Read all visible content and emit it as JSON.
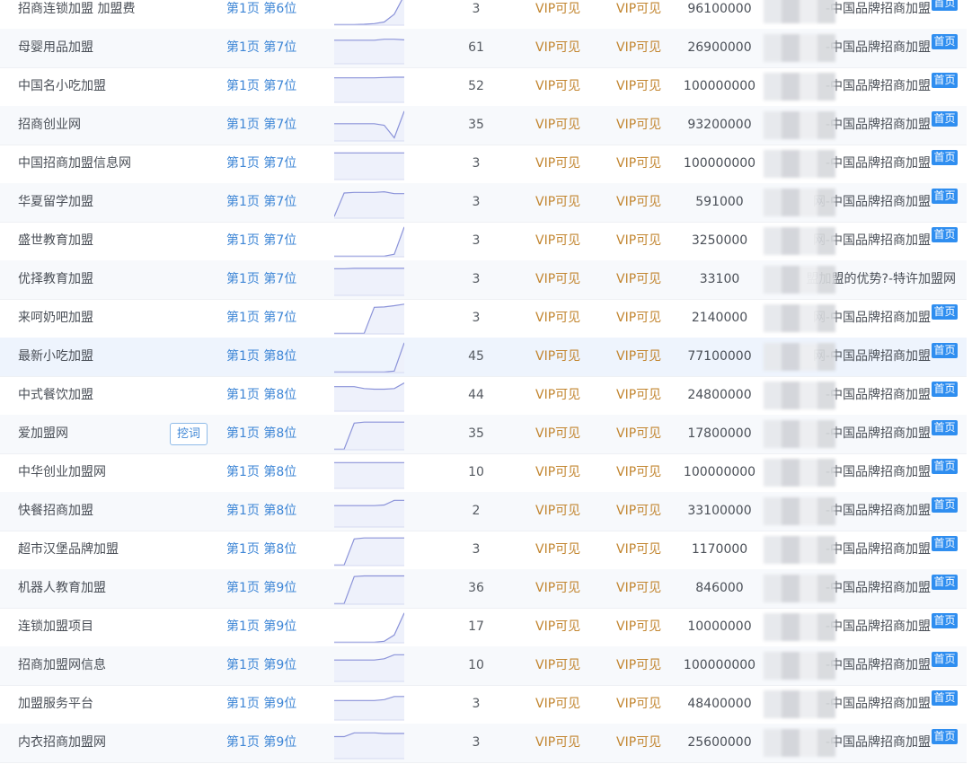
{
  "rows": [
    {
      "keyword": "招商连锁加盟 加盟费",
      "rank": "第1页 第6位",
      "index": "3",
      "vip1": "VIP可见",
      "vip2": "VIP可见",
      "value": "96100000",
      "site": "-中国品牌招商加盟",
      "badge": "首页",
      "spark": [
        0.02,
        0.02,
        0.02,
        0.03,
        0.05,
        0.1,
        0.35,
        0.95
      ]
    },
    {
      "keyword": "母婴用品加盟",
      "rank": "第1页 第7位",
      "index": "61",
      "vip1": "VIP可见",
      "vip2": "VIP可见",
      "value": "26900000",
      "site": "-中国品牌招商加盟",
      "badge": "首页",
      "spark": [
        0.75,
        0.75,
        0.75,
        0.75,
        0.75,
        0.78,
        0.78,
        0.76
      ]
    },
    {
      "keyword": "中国名小吃加盟",
      "rank": "第1页 第7位",
      "index": "52",
      "vip1": "VIP可见",
      "vip2": "VIP可见",
      "value": "100000000",
      "site": "-中国品牌招商加盟",
      "badge": "首页",
      "spark": [
        0.78,
        0.78,
        0.78,
        0.78,
        0.78,
        0.79,
        0.8,
        0.8
      ]
    },
    {
      "keyword": "招商创业网",
      "rank": "第1页 第7位",
      "index": "35",
      "vip1": "VIP可见",
      "vip2": "VIP可见",
      "value": "93200000",
      "site": "-中国品牌招商加盟",
      "badge": "首页",
      "spark": [
        0.55,
        0.55,
        0.55,
        0.55,
        0.55,
        0.5,
        0.1,
        0.95
      ]
    },
    {
      "keyword": "中国招商加盟信息网",
      "rank": "第1页 第7位",
      "index": "3",
      "vip1": "VIP可见",
      "vip2": "VIP可见",
      "value": "100000000",
      "site": "-中国品牌招商加盟",
      "badge": "首页",
      "spark": [
        0.85,
        0.85,
        0.85,
        0.85,
        0.85,
        0.85,
        0.85,
        0.85
      ]
    },
    {
      "keyword": "华夏留学加盟",
      "rank": "第1页 第7位",
      "index": "3",
      "vip1": "VIP可见",
      "vip2": "VIP可见",
      "value": "591000",
      "site": "网-中国品牌招商加盟",
      "badge": "首页",
      "spark": [
        0.05,
        0.8,
        0.82,
        0.82,
        0.82,
        0.84,
        0.78,
        0.78
      ]
    },
    {
      "keyword": "盛世教育加盟",
      "rank": "第1页 第7位",
      "index": "3",
      "vip1": "VIP可见",
      "vip2": "VIP可见",
      "value": "3250000",
      "site": "网-中国品牌招商加盟",
      "badge": "首页",
      "spark": [
        0.02,
        0.02,
        0.02,
        0.02,
        0.02,
        0.02,
        0.08,
        0.95
      ]
    },
    {
      "keyword": "优择教育加盟",
      "rank": "第1页 第7位",
      "index": "3",
      "vip1": "VIP可见",
      "vip2": "VIP可见",
      "value": "33100",
      "site": "盟加盟的优势?-特许加盟网",
      "badge": "",
      "spark": [
        0.85,
        0.85,
        0.86,
        0.86,
        0.86,
        0.86,
        0.86,
        0.86
      ]
    },
    {
      "keyword": "来呵奶吧加盟",
      "rank": "第1页 第7位",
      "index": "3",
      "vip1": "VIP可见",
      "vip2": "VIP可见",
      "value": "2140000",
      "site": "网-中国品牌招商加盟",
      "badge": "首页",
      "spark": [
        0.02,
        0.02,
        0.02,
        0.02,
        0.85,
        0.86,
        0.9,
        0.95
      ]
    },
    {
      "keyword": "最新小吃加盟",
      "rank": "第1页 第8位",
      "index": "45",
      "vip1": "VIP可见",
      "vip2": "VIP可见",
      "value": "77100000",
      "site": "网-中国品牌招商加盟",
      "badge": "首页",
      "spark": [
        0.02,
        0.02,
        0.02,
        0.02,
        0.02,
        0.02,
        0.05,
        0.95
      ]
    },
    {
      "keyword": "中式餐饮加盟",
      "rank": "第1页 第8位",
      "index": "44",
      "vip1": "VIP可见",
      "vip2": "VIP可见",
      "value": "24800000",
      "site": "-中国品牌招商加盟",
      "badge": "首页",
      "spark": [
        0.78,
        0.78,
        0.78,
        0.72,
        0.7,
        0.7,
        0.72,
        0.9
      ]
    },
    {
      "keyword": "爱加盟网",
      "rank": "第1页 第8位",
      "index": "35",
      "vip1": "VIP可见",
      "vip2": "VIP可见",
      "value": "17800000",
      "site": "-中国品牌招商加盟",
      "badge": "首页",
      "dig": "挖词",
      "spark": [
        0.02,
        0.02,
        0.85,
        0.88,
        0.88,
        0.88,
        0.88,
        0.88
      ]
    },
    {
      "keyword": "中华创业加盟网",
      "rank": "第1页 第8位",
      "index": "10",
      "vip1": "VIP可见",
      "vip2": "VIP可见",
      "value": "100000000",
      "site": "-中国品牌招商加盟",
      "badge": "首页",
      "spark": [
        0.82,
        0.82,
        0.82,
        0.82,
        0.82,
        0.82,
        0.82,
        0.82
      ]
    },
    {
      "keyword": "快餐招商加盟",
      "rank": "第1页 第8位",
      "index": "2",
      "vip1": "VIP可见",
      "vip2": "VIP可见",
      "value": "33100000",
      "site": "-中国品牌招商加盟",
      "badge": "首页",
      "spark": [
        0.68,
        0.68,
        0.68,
        0.68,
        0.68,
        0.7,
        0.85,
        0.85
      ]
    },
    {
      "keyword": "超市汉堡品牌加盟",
      "rank": "第1页 第8位",
      "index": "3",
      "vip1": "VIP可见",
      "vip2": "VIP可见",
      "value": "1170000",
      "site": "-中国品牌招商加盟",
      "badge": "首页",
      "spark": [
        0.02,
        0.02,
        0.85,
        0.88,
        0.88,
        0.88,
        0.88,
        0.88
      ]
    },
    {
      "keyword": "机器人教育加盟",
      "rank": "第1页 第9位",
      "index": "36",
      "vip1": "VIP可见",
      "vip2": "VIP可见",
      "value": "846000",
      "site": "-中国品牌招商加盟",
      "badge": "首页",
      "spark": [
        0.02,
        0.02,
        0.88,
        0.9,
        0.9,
        0.9,
        0.9,
        0.9
      ]
    },
    {
      "keyword": "连锁加盟项目",
      "rank": "第1页 第9位",
      "index": "17",
      "vip1": "VIP可见",
      "vip2": "VIP可见",
      "value": "10000000",
      "site": "-中国品牌招商加盟",
      "badge": "首页",
      "spark": [
        0.02,
        0.02,
        0.02,
        0.02,
        0.02,
        0.05,
        0.25,
        0.95
      ]
    },
    {
      "keyword": "招商加盟网信息",
      "rank": "第1页 第9位",
      "index": "10",
      "vip1": "VIP可见",
      "vip2": "VIP可见",
      "value": "100000000",
      "site": "-中国品牌招商加盟",
      "badge": "首页",
      "spark": [
        0.68,
        0.68,
        0.68,
        0.68,
        0.68,
        0.72,
        0.85,
        0.85
      ]
    },
    {
      "keyword": "加盟服务平台",
      "rank": "第1页 第9位",
      "index": "3",
      "vip1": "VIP可见",
      "vip2": "VIP可见",
      "value": "48400000",
      "site": "-中国品牌招商加盟",
      "badge": "首页",
      "spark": [
        0.62,
        0.62,
        0.62,
        0.62,
        0.62,
        0.65,
        0.75,
        0.75
      ]
    },
    {
      "keyword": "内衣招商加盟网",
      "rank": "第1页 第9位",
      "index": "3",
      "vip1": "VIP可见",
      "vip2": "VIP可见",
      "value": "25600000",
      "site": "-中国品牌招商加盟",
      "badge": "首页",
      "spark": [
        0.7,
        0.7,
        0.82,
        0.82,
        0.82,
        0.8,
        0.8,
        0.8
      ]
    }
  ],
  "colors": {
    "rank": "#3e86d6",
    "vip": "#c2852f",
    "badge": "#2f8ef0",
    "spark_line": "#8b93d9",
    "spark_fill": "#eef1fb"
  }
}
